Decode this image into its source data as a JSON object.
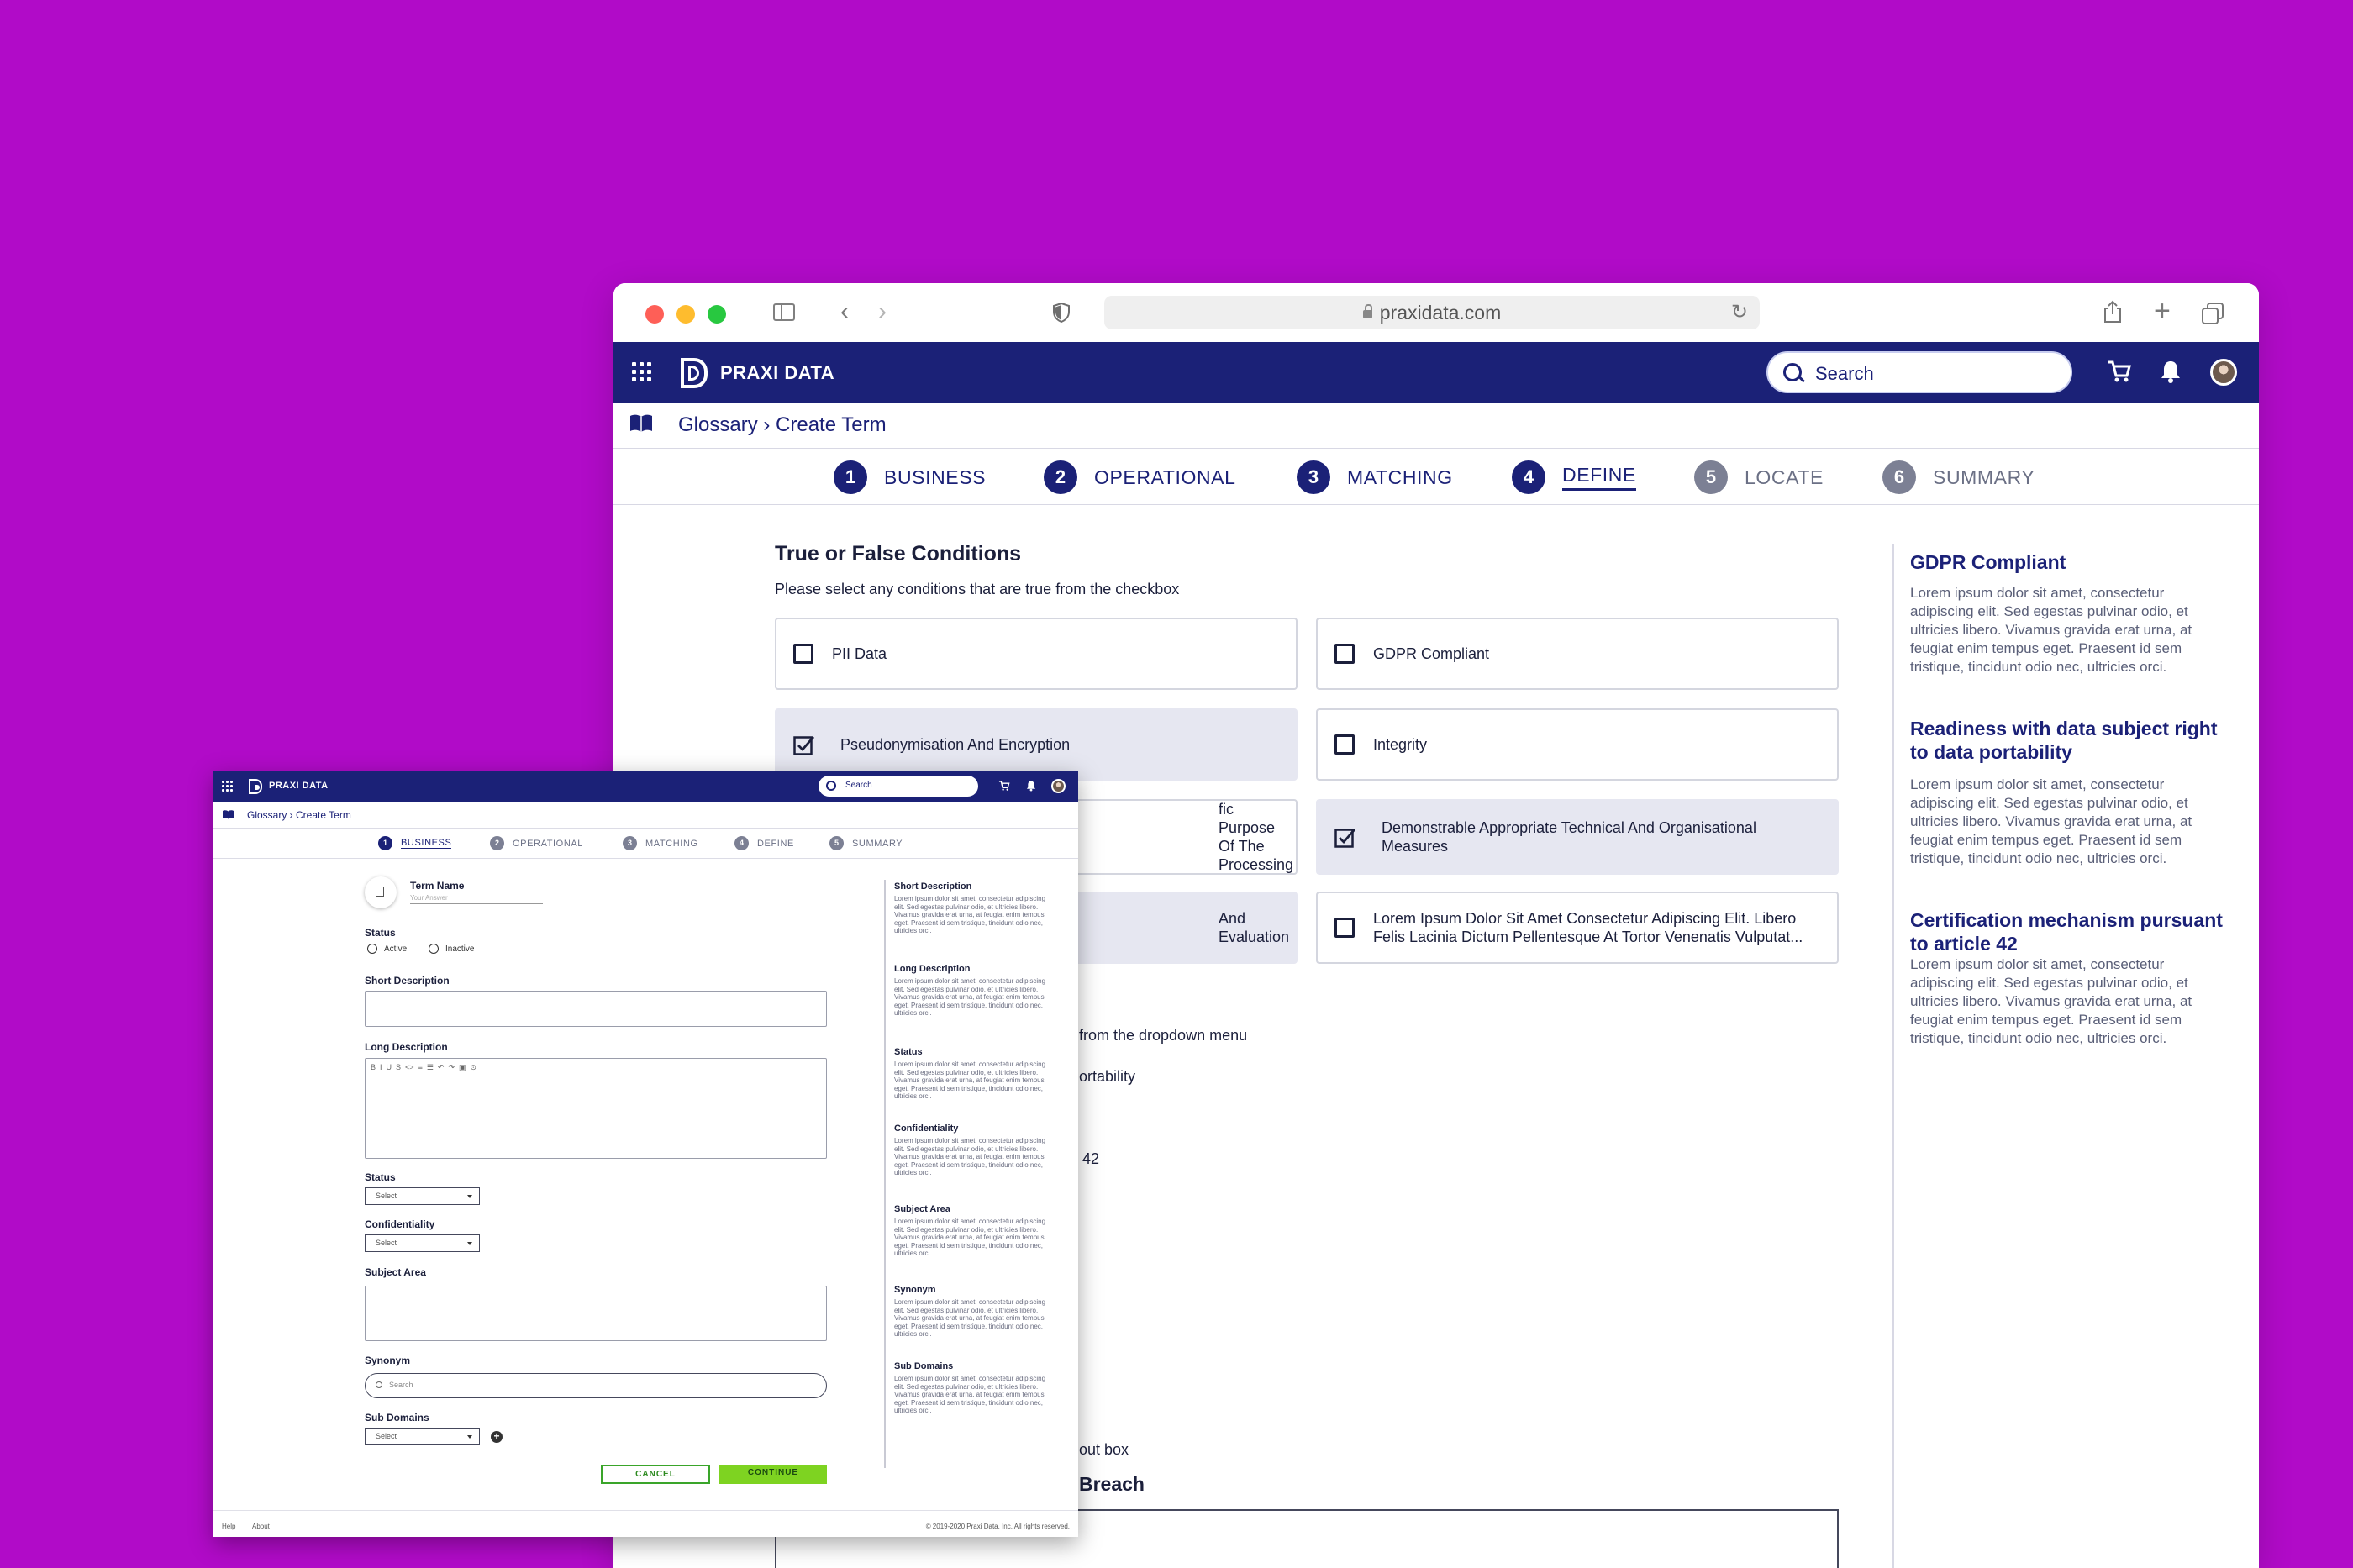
{
  "browser": {
    "url": "praxidata.com"
  },
  "app": {
    "brand": "PRAXI DATA",
    "search_placeholder": "Search"
  },
  "breadcrumb": "Glossary › Create Term",
  "big_steps": [
    {
      "num": "1",
      "label": "BUSINESS"
    },
    {
      "num": "2",
      "label": "OPERATIONAL"
    },
    {
      "num": "3",
      "label": "MATCHING"
    },
    {
      "num": "4",
      "label": "DEFINE"
    },
    {
      "num": "5",
      "label": "LOCATE"
    },
    {
      "num": "6",
      "label": "SUMMARY"
    }
  ],
  "conditions": {
    "title": "True or False Conditions",
    "subtitle": "Please select any conditions that are true from the checkbox",
    "items": [
      {
        "label": "PII Data",
        "checked": false
      },
      {
        "label": "GDPR Compliant",
        "checked": false
      },
      {
        "label": "Pseudonymisation And Encryption",
        "checked": true
      },
      {
        "label": "Integrity",
        "checked": false
      },
      {
        "label": "fic Purpose Of The Processing",
        "checked": false
      },
      {
        "label": "Demonstrable Appropriate Technical And Organisational Measures",
        "checked": true
      },
      {
        "label": "And Evaluation",
        "checked": false
      },
      {
        "label": "Lorem Ipsum Dolor Sit Amet Consectetur Adipiscing Elit. Libero Felis Lacinia Dictum Pellentesque At Tortor Venenatis Vulputat...",
        "checked": false
      }
    ]
  },
  "partial_texts": {
    "dropdown_hint": "from the dropdown menu",
    "portability": "ortability",
    "article": "42",
    "input_box": "out box",
    "breach": "Breach"
  },
  "help": [
    {
      "title": "GDPR Compliant",
      "body": "Lorem ipsum dolor sit amet, consectetur adipiscing elit. Sed egestas pulvinar odio, et ultricies libero. Vivamus gravida erat urna, at feugiat enim tempus eget. Praesent id sem tristique, tincidunt odio nec, ultricies orci."
    },
    {
      "title": "Readiness with data subject right to data portability",
      "body": "Lorem ipsum dolor sit amet, consectetur adipiscing elit. Sed egestas pulvinar odio, et ultricies libero. Vivamus gravida erat urna, at feugiat enim tempus eget. Praesent id sem tristique, tincidunt odio nec, ultricies orci."
    },
    {
      "title": "Certification mechanism pursuant to article 42",
      "body": "Lorem ipsum dolor sit amet, consectetur adipiscing elit. Sed egestas pulvinar odio, et ultricies libero. Vivamus gravida erat urna, at feugiat enim tempus eget. Praesent id sem tristique, tincidunt odio nec, ultricies orci."
    }
  ],
  "small": {
    "steps": [
      {
        "num": "1",
        "label": "BUSINESS"
      },
      {
        "num": "2",
        "label": "OPERATIONAL"
      },
      {
        "num": "3",
        "label": "MATCHING"
      },
      {
        "num": "4",
        "label": "DEFINE"
      },
      {
        "num": "5",
        "label": "SUMMARY"
      }
    ],
    "term_name_label": "Term Name",
    "term_name_placeholder": "Your Answer",
    "status_label": "Status",
    "radio_active": "Active",
    "radio_inactive": "Inactive",
    "short_desc_label": "Short Description",
    "long_desc_label": "Long Description",
    "toolbar": [
      "B",
      "I",
      "U",
      "S",
      "<>",
      "≡",
      "☰",
      "↶",
      "↷",
      "▣",
      "⊙"
    ],
    "status2_label": "Status",
    "select_placeholder": "Select",
    "confidentiality_label": "Confidentiality",
    "subject_area_label": "Subject Area",
    "synonym_label": "Synonym",
    "synonym_placeholder": "Search",
    "sub_domains_label": "Sub Domains",
    "cancel": "CANCEL",
    "continue": "CONTINUE",
    "footer_help": "Help",
    "footer_about": "About",
    "copyright": "© 2019-2020 Praxi Data, Inc. All rights reserved.",
    "help": [
      {
        "title": "Short Description",
        "body": "Lorem ipsum dolor sit amet, consectetur adipiscing elit. Sed egestas pulvinar odio, et ultricies libero. Vivamus gravida erat urna, at feugiat enim tempus eget. Praesent id sem tristique, tincidunt odio nec, ultricies orci."
      },
      {
        "title": "Long Description",
        "body": "Lorem ipsum dolor sit amet, consectetur adipiscing elit. Sed egestas pulvinar odio, et ultricies libero. Vivamus gravida erat urna, at feugiat enim tempus eget. Praesent id sem tristique, tincidunt odio nec, ultricies orci."
      },
      {
        "title": "Status",
        "body": "Lorem ipsum dolor sit amet, consectetur adipiscing elit. Sed egestas pulvinar odio, et ultricies libero. Vivamus gravida erat urna, at feugiat enim tempus eget. Praesent id sem tristique, tincidunt odio nec, ultricies orci."
      },
      {
        "title": "Confidentiality",
        "body": "Lorem ipsum dolor sit amet, consectetur adipiscing elit. Sed egestas pulvinar odio, et ultricies libero. Vivamus gravida erat urna, at feugiat enim tempus eget. Praesent id sem tristique, tincidunt odio nec, ultricies orci."
      },
      {
        "title": "Subject Area",
        "body": "Lorem ipsum dolor sit amet, consectetur adipiscing elit. Sed egestas pulvinar odio, et ultricies libero. Vivamus gravida erat urna, at feugiat enim tempus eget. Praesent id sem tristique, tincidunt odio nec, ultricies orci."
      },
      {
        "title": "Synonym",
        "body": "Lorem ipsum dolor sit amet, consectetur adipiscing elit. Sed egestas pulvinar odio, et ultricies libero. Vivamus gravida erat urna, at feugiat enim tempus eget. Praesent id sem tristique, tincidunt odio nec, ultricies orci."
      },
      {
        "title": "Sub Domains",
        "body": "Lorem ipsum dolor sit amet, consectetur adipiscing elit. Sed egestas pulvinar odio, et ultricies libero. Vivamus gravida erat urna, at feugiat enim tempus eget. Praesent id sem tristique, tincidunt odio nec, ultricies orci."
      }
    ]
  },
  "colors": {
    "background": "#b10bc8",
    "navy": "#1b2177",
    "continue_green": "#7ed321",
    "selected_card": "#e6e7f1"
  }
}
